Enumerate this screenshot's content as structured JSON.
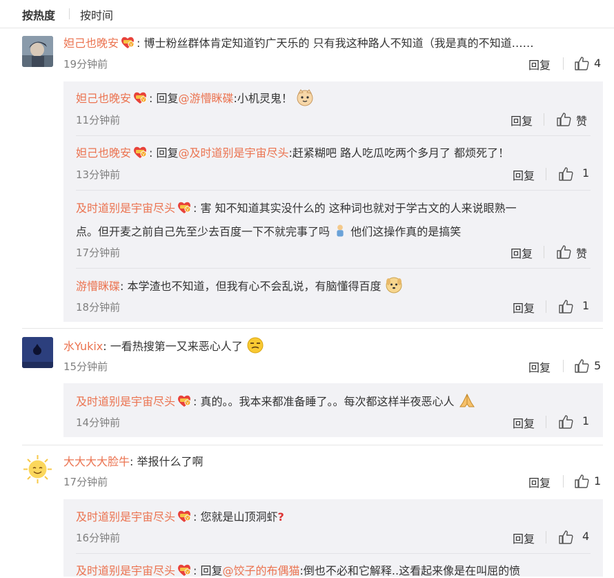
{
  "sort": {
    "hot": "按热度",
    "time": "按时间"
  },
  "labels": {
    "reply": "回复"
  },
  "colors": {
    "name": "#eb7350",
    "text": "#333333",
    "time": "#808080",
    "subbg": "#f2f2f5"
  },
  "comments": [
    {
      "name": "妲己也晚安",
      "text": "博士粉丝群体肯定知道钓广天乐的 只有我这种路人不知道（我是真的不知道……",
      "time": "19分钟前",
      "likes": "4",
      "replies": [
        {
          "name": "妲己也晚安",
          "prefix": "回复",
          "at": "@游懵眯碟",
          "text": ":小机灵鬼！",
          "time": "11分钟前",
          "likes": "赞"
        },
        {
          "name": "妲己也晚安",
          "prefix": "回复",
          "at": "@及时道别是宇宙尽头",
          "text": ":赶紧糊吧 路人吃瓜吃两个多月了 都烦死了！",
          "time": "13分钟前",
          "likes": "1"
        },
        {
          "name": "及时道别是宇宙尽头",
          "text1": "害 知不知道其实没什么的 这种词也就对于学古文的人来说眼熟一",
          "text2": "点。但开麦之前自己先至少去百度一下不就完事了吗",
          "text3": "他们这操作真的是搞笑",
          "time": "17分钟前",
          "likes": "赞"
        },
        {
          "name": "游懵眯碟",
          "text": "本学渣也不知道，但我有心不会乱说，有脑懂得百度",
          "time": "18分钟前",
          "likes": "1"
        }
      ]
    },
    {
      "name": "水Yukix",
      "text": "一看热搜第一又来恶心人了",
      "time": "15分钟前",
      "likes": "5",
      "replies": [
        {
          "name": "及时道别是宇宙尽头",
          "text": "真的。。我本来都准备睡了。。每次都这样半夜恶心人",
          "time": "14分钟前",
          "likes": "1"
        }
      ]
    },
    {
      "name": "大大大大脸牛",
      "text": "举报什么了啊",
      "time": "17分钟前",
      "likes": "1",
      "replies": [
        {
          "name": "及时道别是宇宙尽头",
          "text": "您就是山顶洞虾",
          "time": "16分钟前",
          "likes": "4"
        },
        {
          "name": "及时道别是宇宙尽头",
          "prefix": "回复",
          "at": "@饺子的布偶猫",
          "text": ":倒也不必和它解释..这看起来像是在叫屈的愤"
        }
      ]
    }
  ]
}
